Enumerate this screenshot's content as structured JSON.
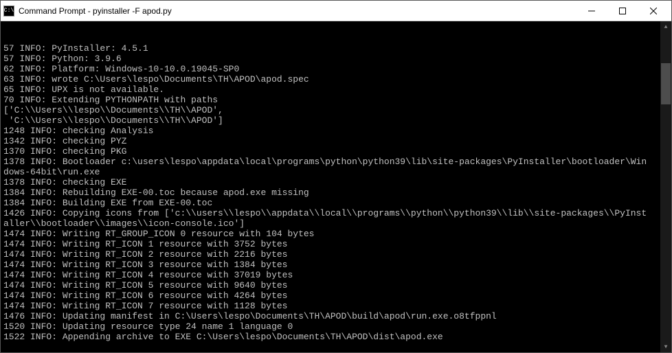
{
  "titlebar": {
    "icon_label": "C:\\",
    "title": "Command Prompt - pyinstaller  -F apod.py"
  },
  "terminal": {
    "lines": [
      "57 INFO: PyInstaller: 4.5.1",
      "57 INFO: Python: 3.9.6",
      "62 INFO: Platform: Windows-10-10.0.19045-SP0",
      "63 INFO: wrote C:\\Users\\lespo\\Documents\\TH\\APOD\\apod.spec",
      "65 INFO: UPX is not available.",
      "70 INFO: Extending PYTHONPATH with paths",
      "['C:\\\\Users\\\\lespo\\\\Documents\\\\TH\\\\APOD',",
      " 'C:\\\\Users\\\\lespo\\\\Documents\\\\TH\\\\APOD']",
      "1248 INFO: checking Analysis",
      "1342 INFO: checking PYZ",
      "1370 INFO: checking PKG",
      "1378 INFO: Bootloader c:\\users\\lespo\\appdata\\local\\programs\\python\\python39\\lib\\site-packages\\PyInstaller\\bootloader\\Win",
      "dows-64bit\\run.exe",
      "1378 INFO: checking EXE",
      "1384 INFO: Rebuilding EXE-00.toc because apod.exe missing",
      "1384 INFO: Building EXE from EXE-00.toc",
      "1426 INFO: Copying icons from ['c:\\\\users\\\\lespo\\\\appdata\\\\local\\\\programs\\\\python\\\\python39\\\\lib\\\\site-packages\\\\PyInst",
      "aller\\\\bootloader\\\\images\\\\icon-console.ico']",
      "1474 INFO: Writing RT_GROUP_ICON 0 resource with 104 bytes",
      "1474 INFO: Writing RT_ICON 1 resource with 3752 bytes",
      "1474 INFO: Writing RT_ICON 2 resource with 2216 bytes",
      "1474 INFO: Writing RT_ICON 3 resource with 1384 bytes",
      "1474 INFO: Writing RT_ICON 4 resource with 37019 bytes",
      "1474 INFO: Writing RT_ICON 5 resource with 9640 bytes",
      "1474 INFO: Writing RT_ICON 6 resource with 4264 bytes",
      "1474 INFO: Writing RT_ICON 7 resource with 1128 bytes",
      "1476 INFO: Updating manifest in C:\\Users\\lespo\\Documents\\TH\\APOD\\build\\apod\\run.exe.o8tfppnl",
      "1520 INFO: Updating resource type 24 name 1 language 0",
      "1522 INFO: Appending archive to EXE C:\\Users\\lespo\\Documents\\TH\\APOD\\dist\\apod.exe"
    ]
  }
}
